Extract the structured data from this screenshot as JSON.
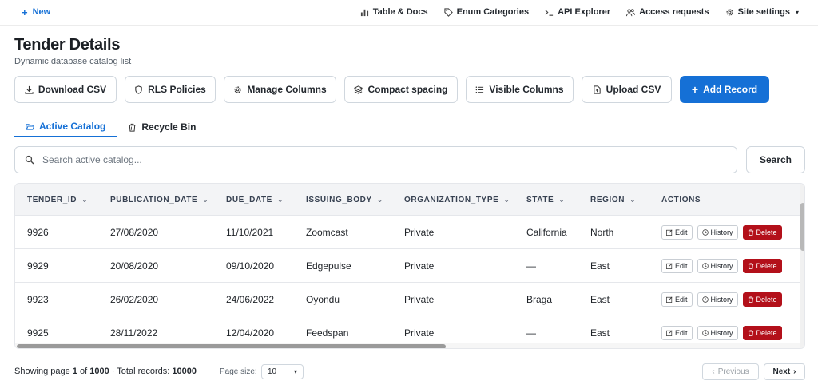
{
  "nav": {
    "new_label": "New",
    "links": [
      {
        "label": "Table & Docs",
        "icon": "bar-chart-icon"
      },
      {
        "label": "Enum Categories",
        "icon": "tag-icon"
      },
      {
        "label": "API Explorer",
        "icon": "terminal-icon"
      },
      {
        "label": "Access requests",
        "icon": "users-icon"
      },
      {
        "label": "Site settings",
        "icon": "gear-icon"
      }
    ]
  },
  "header": {
    "title": "Tender Details",
    "subtitle": "Dynamic database catalog list"
  },
  "toolbar": {
    "download_csv": "Download CSV",
    "rls_policies": "RLS Policies",
    "manage_columns": "Manage Columns",
    "compact_spacing": "Compact spacing",
    "visible_columns": "Visible Columns",
    "upload_csv": "Upload CSV",
    "add_record": "Add Record"
  },
  "tabs": {
    "active_catalog": "Active Catalog",
    "recycle_bin": "Recycle Bin"
  },
  "search": {
    "placeholder": "Search active catalog...",
    "button": "Search"
  },
  "table": {
    "columns": [
      "TENDER_ID",
      "PUBLICATION_DATE",
      "DUE_DATE",
      "ISSUING_BODY",
      "ORGANIZATION_TYPE",
      "STATE",
      "REGION",
      "ACTIONS"
    ],
    "rows": [
      [
        "9926",
        "27/08/2020",
        "11/10/2021",
        "Zoomcast",
        "Private",
        "California",
        "North"
      ],
      [
        "9929",
        "20/08/2020",
        "09/10/2020",
        "Edgepulse",
        "Private",
        "—",
        "East"
      ],
      [
        "9923",
        "26/02/2020",
        "24/06/2022",
        "Oyondu",
        "Private",
        "Braga",
        "East"
      ],
      [
        "9925",
        "28/11/2022",
        "12/04/2020",
        "Feedspan",
        "Private",
        "—",
        "East"
      ]
    ],
    "actions": {
      "edit": "Edit",
      "history": "History",
      "delete": "Delete"
    }
  },
  "footer": {
    "showing_prefix": "Showing page",
    "page": "1",
    "of": "of",
    "total_pages": "1000",
    "total_label": "· Total records:",
    "total_records": "10000",
    "page_size_label": "Page size:",
    "page_size": "10",
    "previous": "Previous",
    "next": "Next"
  },
  "colors": {
    "primary": "#1570d6",
    "danger": "#b3101a",
    "header_bg": "#f3f4f6"
  }
}
